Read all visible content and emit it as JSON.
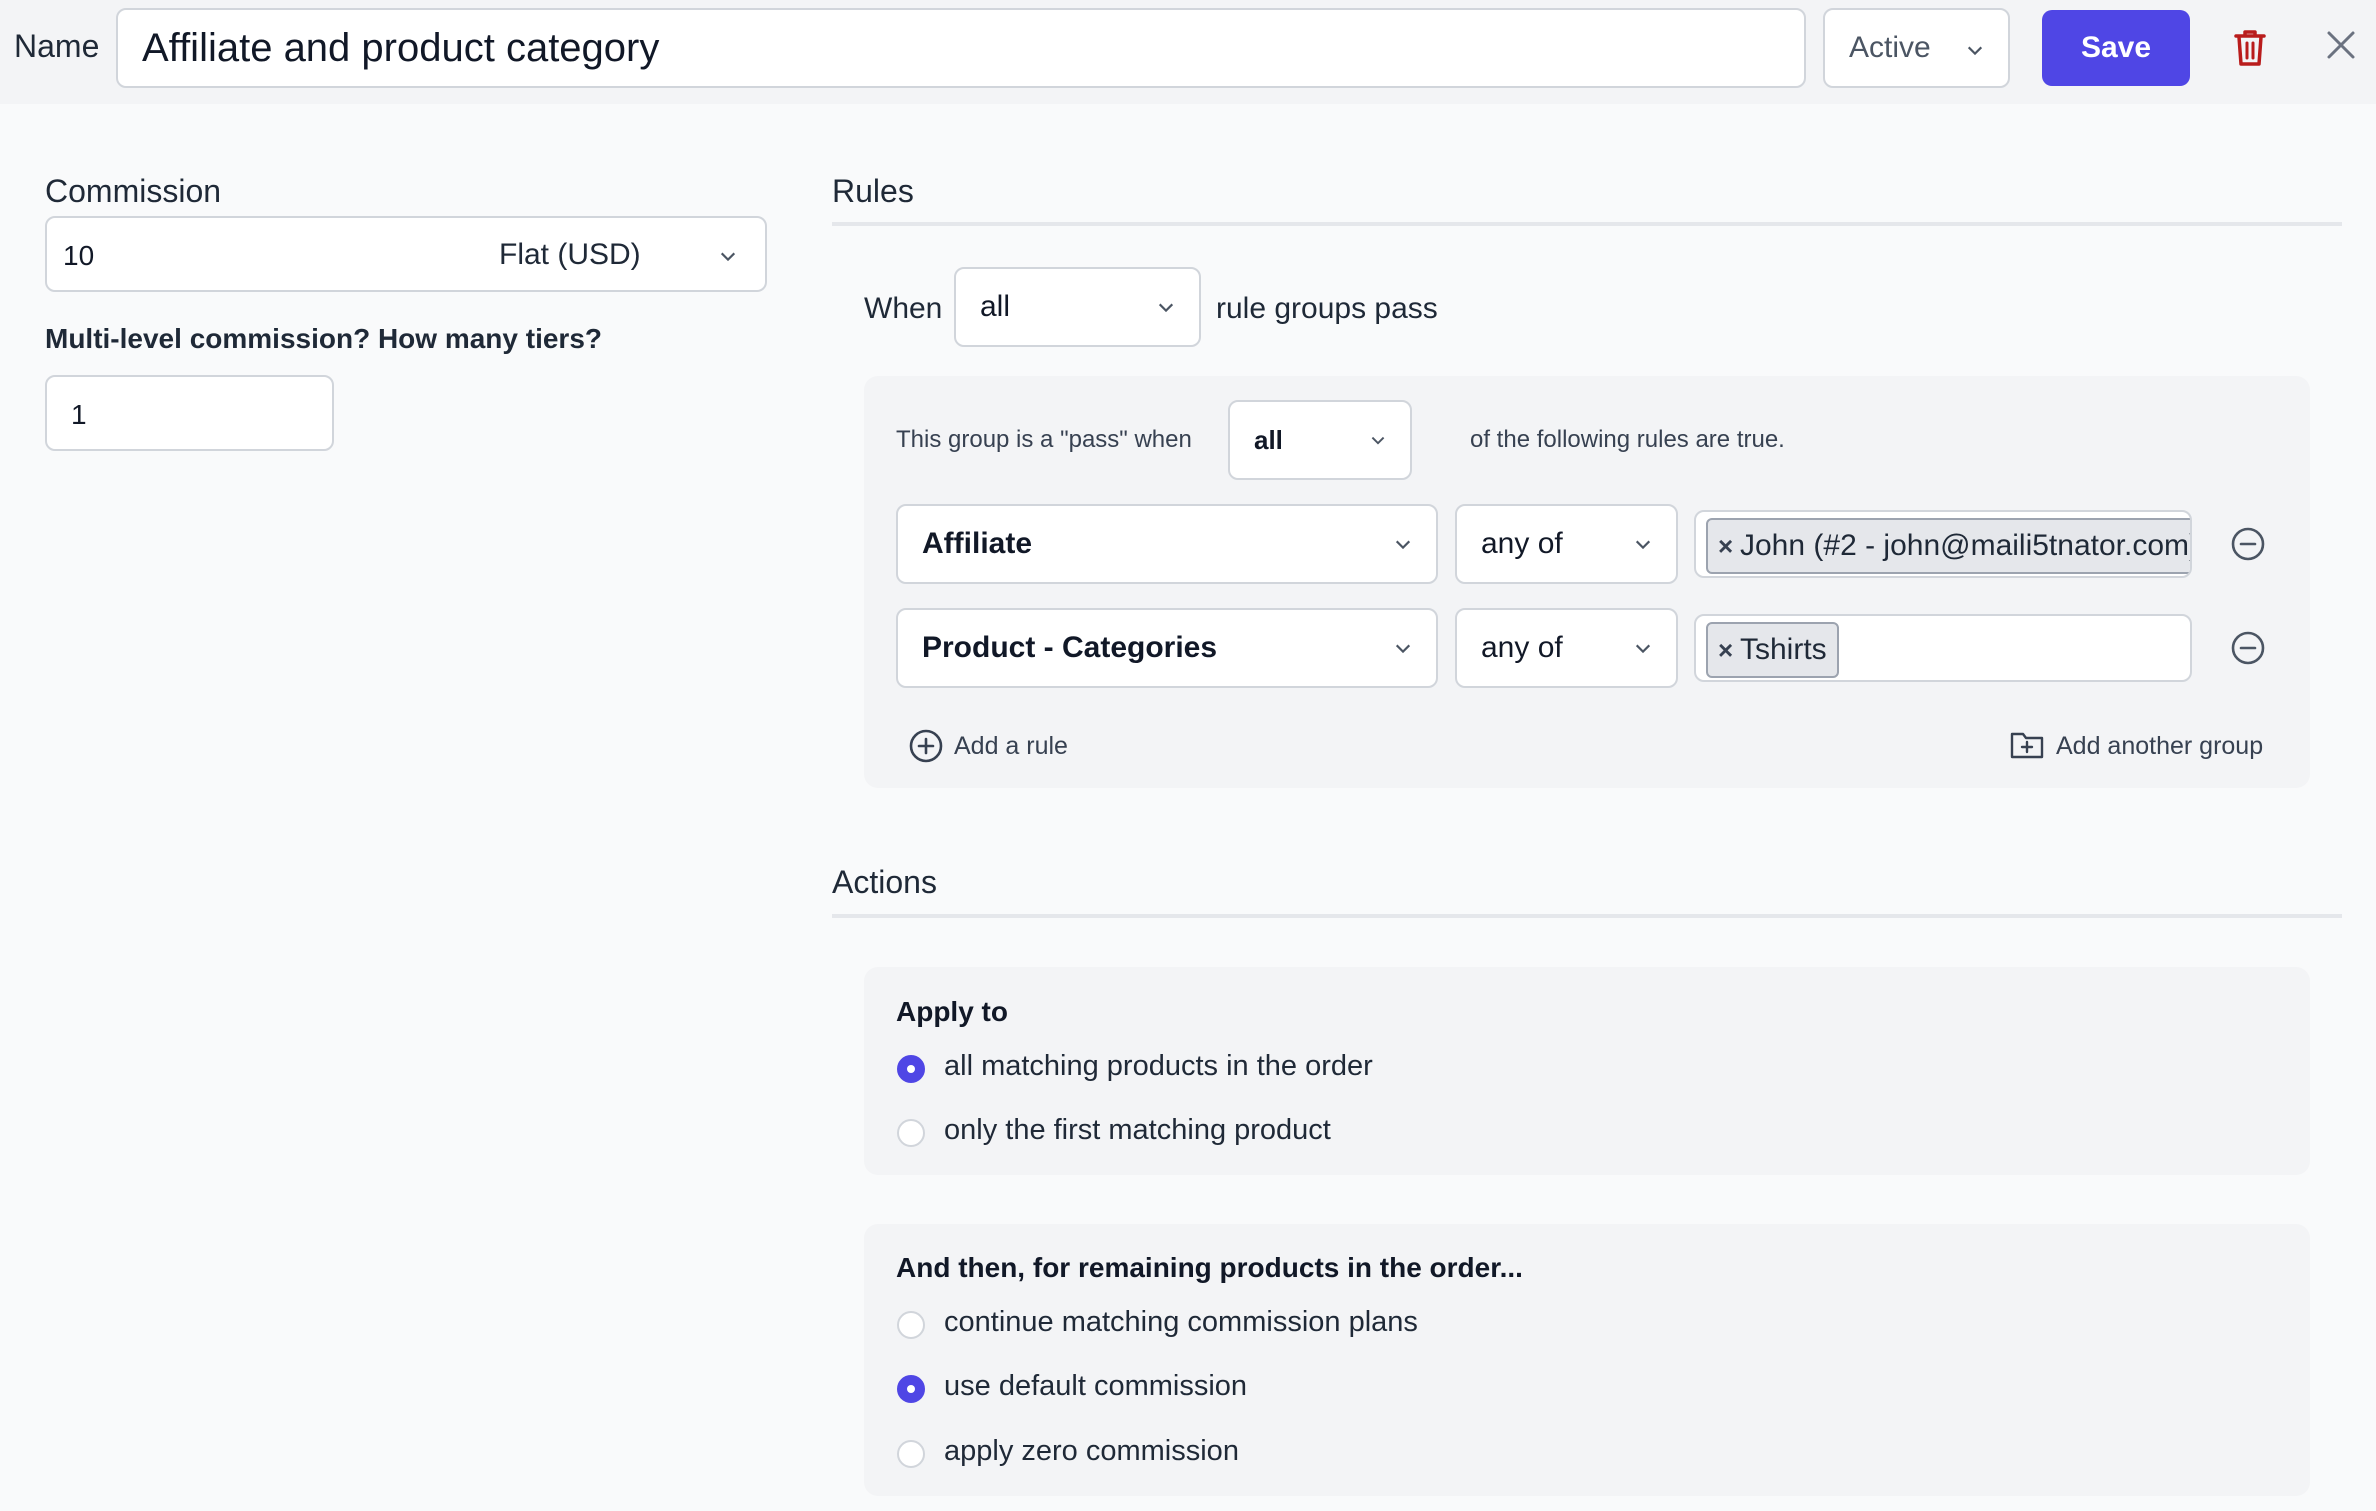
{
  "header": {
    "name_label": "Name",
    "name_value": "Affiliate and product category",
    "status": "Active",
    "save_label": "Save"
  },
  "commission": {
    "label": "Commission",
    "amount": "10",
    "type": "Flat (USD)",
    "tiers_label": "Multi-level commission? How many tiers?",
    "tiers_value": "1"
  },
  "rules": {
    "title": "Rules",
    "when_label": "When",
    "when_value": "all",
    "groups_pass_label": "rule groups pass",
    "group": {
      "pass_prefix": "This group is a \"pass\" when",
      "pass_value": "all",
      "pass_suffix": "of the following rules are true.",
      "rows": [
        {
          "field": "Affiliate",
          "operator": "any of",
          "tag": "John (#2 - john@maili5tnator.com)"
        },
        {
          "field": "Product - Categories",
          "operator": "any of",
          "tag": "Tshirts"
        }
      ],
      "add_rule_label": "Add a rule",
      "add_group_label": "Add another group"
    }
  },
  "actions": {
    "title": "Actions",
    "apply_to": {
      "title": "Apply to",
      "options": [
        {
          "label": "all matching products in the order",
          "selected": true
        },
        {
          "label": "only the first matching product",
          "selected": false
        }
      ]
    },
    "remaining": {
      "title": "And then, for remaining products in the order...",
      "options": [
        {
          "label": "continue matching commission plans",
          "selected": false
        },
        {
          "label": "use default commission",
          "selected": true
        },
        {
          "label": "apply zero commission",
          "selected": false
        }
      ]
    }
  },
  "colors": {
    "accent": "#4f46e5",
    "danger": "#b91c1c",
    "panel": "#f3f4f6"
  }
}
